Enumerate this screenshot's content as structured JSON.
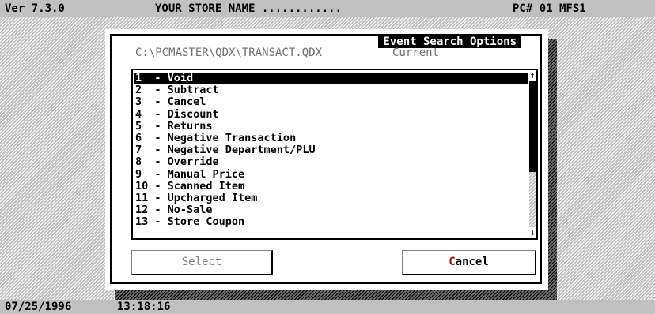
{
  "header": {
    "version": "Ver 7.3.0",
    "store_name": "YOUR STORE NAME ............",
    "terminal": "PC# 01 MFS1"
  },
  "dialog": {
    "title": "Event Search Options",
    "file_path": "C:\\PCMASTER\\QDX\\TRANSACT.QDX",
    "file_status": "Current",
    "items": [
      {
        "label": "1  - Void"
      },
      {
        "label": "2  - Subtract"
      },
      {
        "label": "3  - Cancel"
      },
      {
        "label": "4  - Discount"
      },
      {
        "label": "5  - Returns"
      },
      {
        "label": "6  - Negative Transaction"
      },
      {
        "label": "7  - Negative Department/PLU"
      },
      {
        "label": "8  - Override"
      },
      {
        "label": "9  - Manual Price"
      },
      {
        "label": "10 - Scanned Item"
      },
      {
        "label": "11 - Upcharged Item"
      },
      {
        "label": "12 - No-Sale"
      },
      {
        "label": "13 - Store Coupon"
      }
    ],
    "selected_index": 0,
    "scroll_up_glyph": "↑",
    "scroll_down_glyph": "↓",
    "buttons": {
      "select_label": "Select",
      "cancel_hotkey": "C",
      "cancel_rest": "ancel"
    }
  },
  "status": {
    "date": "07/25/1996",
    "time": "13:18:16"
  }
}
